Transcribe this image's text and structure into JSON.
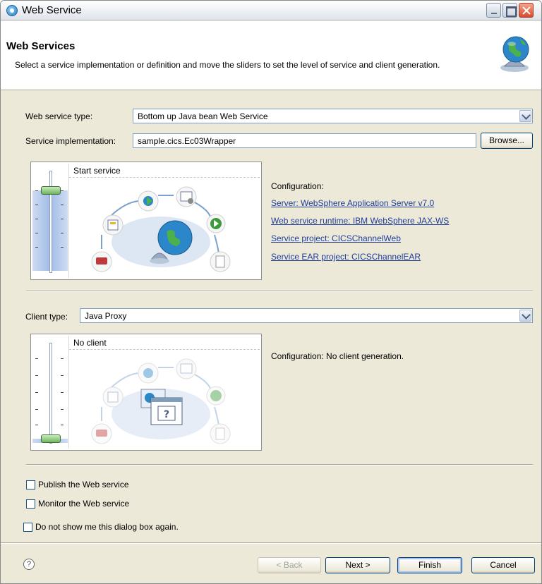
{
  "window": {
    "title": "Web Service"
  },
  "banner": {
    "title": "Web Services",
    "description": "Select a service implementation or definition and move the sliders to set the level of service and client generation."
  },
  "service": {
    "type_label": "Web service type:",
    "type_value": "Bottom up Java bean Web Service",
    "impl_label": "Service implementation:",
    "impl_value": "sample.cics.Ec03Wrapper",
    "browse_label": "Browse...",
    "slider_caption": "Start service",
    "slider_level": 0.857,
    "config_heading": "Configuration:",
    "links": {
      "server": "Server: WebSphere Application Server v7.0",
      "runtime": "Web service runtime: IBM WebSphere JAX-WS",
      "project": "Service project: CICSChannelWeb",
      "ear": "Service EAR project: CICSChannelEAR"
    }
  },
  "client": {
    "type_label": "Client type:",
    "type_value": "Java Proxy",
    "slider_caption": "No client",
    "slider_level": 0,
    "config_text": "Configuration: No client generation."
  },
  "options": {
    "publish": "Publish the Web service",
    "monitor": "Monitor the Web service",
    "dont_show": "Do not show me this dialog box again."
  },
  "buttons": {
    "back": "< Back",
    "next": "Next >",
    "finish": "Finish",
    "cancel": "Cancel",
    "help": "?"
  },
  "colors": {
    "link": "#1f3d99",
    "slider_fill": "#a8c4ef",
    "thumb": "#6fb55f"
  }
}
